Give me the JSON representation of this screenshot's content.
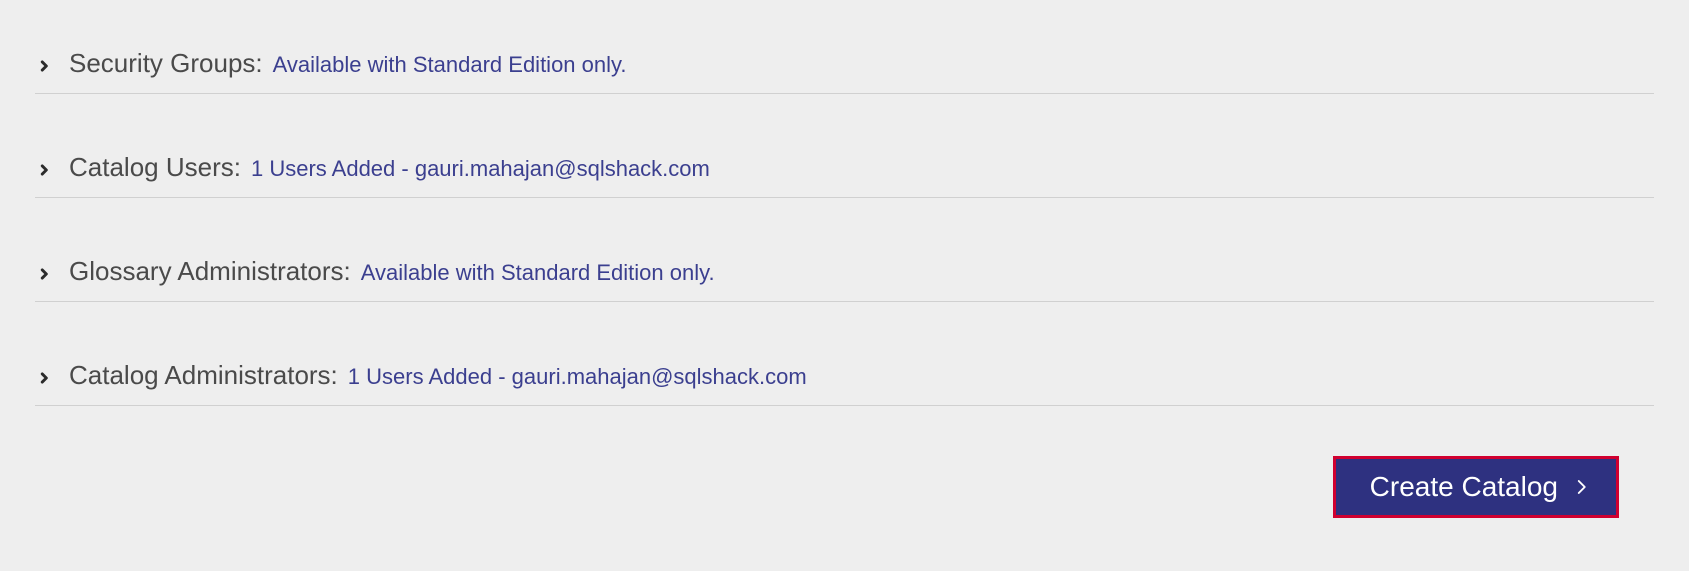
{
  "sections": {
    "securityGroups": {
      "label": "Security Groups:",
      "value": "Available with Standard Edition only."
    },
    "catalogUsers": {
      "label": "Catalog Users:",
      "value": "1 Users Added - gauri.mahajan@sqlshack.com"
    },
    "glossaryAdministrators": {
      "label": "Glossary Administrators:",
      "value": "Available with Standard Edition only."
    },
    "catalogAdministrators": {
      "label": "Catalog Administrators:",
      "value": "1 Users Added - gauri.mahajan@sqlshack.com"
    }
  },
  "actions": {
    "createCatalog": "Create Catalog"
  }
}
